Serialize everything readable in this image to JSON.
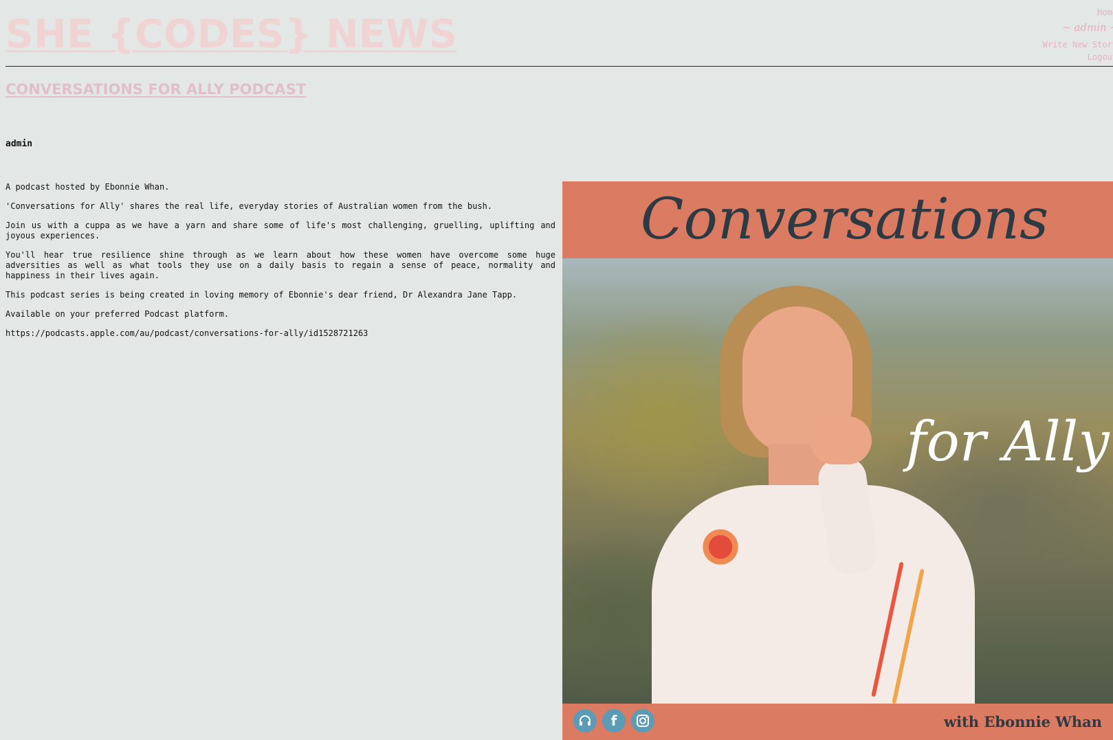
{
  "site": {
    "title": "SHE {CODES} NEWS"
  },
  "nav": {
    "home": "Home",
    "user": "~ admin ~",
    "write": "Write New Story",
    "logout": "Logout"
  },
  "post": {
    "title": "CONVERSATIONS FOR ALLY PODCAST",
    "author": "admin",
    "paragraphs": [
      "A podcast hosted by Ebonnie Whan.",
      "'Conversations for Ally' shares the real life, everyday stories of Australian women from the bush.",
      "Join us with a cuppa as we have a yarn and share some of life's most challenging, gruelling, uplifting and joyous experiences.",
      "You'll hear true resilience shine through as we learn about how these women have overcome some huge adversities as well as what tools they use on a daily basis to regain a sense of peace, normality and happiness in their lives again.",
      "This podcast series is being created in loving memory of Ebonnie's dear friend, Dr Alexandra Jane Tapp.",
      "Available on your preferred Podcast platform.",
      "https://podcasts.apple.com/au/podcast/conversations-for-ally/id1528721263"
    ]
  },
  "cover": {
    "title": "Conversations",
    "subtitle": "for Ally",
    "byline": "with Ebonnie Whan",
    "icons": [
      "headphones-icon",
      "facebook-icon",
      "instagram-icon"
    ]
  },
  "colors": {
    "background": "#e3e8e6",
    "site_title": "#f0d4d4",
    "post_title": "#e0bfcb",
    "nav_link": "#e3b3c0",
    "cover_band": "#db7c62",
    "icon_blue": "#5c9bb6"
  }
}
